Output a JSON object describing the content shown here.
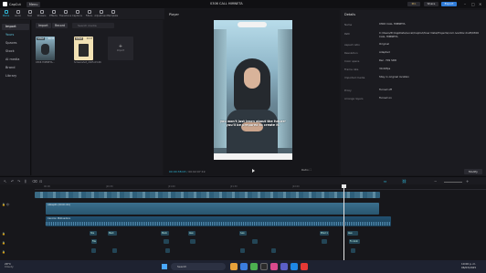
{
  "titlebar": {
    "app_name": "CapCut",
    "menu_label": "Menu",
    "project_name": "0306 CALL HIMNETA",
    "pro_label": "Pro",
    "share_label": "Share",
    "export_label": "Export",
    "minimize": "–",
    "maximize": "□",
    "close": "✕"
  },
  "toolbar": {
    "items": [
      {
        "label": "Media",
        "icon": "media-icon"
      },
      {
        "label": "Audio",
        "icon": "audio-icon"
      },
      {
        "label": "Text",
        "icon": "text-icon"
      },
      {
        "label": "Stickers",
        "icon": "stickers-icon"
      },
      {
        "label": "Effects",
        "icon": "effects-icon"
      },
      {
        "label": "Transitions",
        "icon": "transitions-icon"
      },
      {
        "label": "Captions",
        "icon": "captions-icon"
      },
      {
        "label": "Filters",
        "icon": "filters-icon"
      },
      {
        "label": "Adjustment",
        "icon": "adjustment-icon"
      },
      {
        "label": "Template",
        "icon": "template-icon"
      }
    ]
  },
  "leftnav": {
    "items": [
      {
        "label": "Import"
      },
      {
        "label": "Yours"
      },
      {
        "label": "Spaces"
      },
      {
        "label": "Stock"
      },
      {
        "label": "AI media"
      },
      {
        "label": "Brand"
      },
      {
        "label": "Library"
      }
    ]
  },
  "media": {
    "import_label": "Import",
    "record_label": "Record",
    "search_placeholder": "Search media",
    "thumbs": [
      {
        "label": "Added",
        "duration": "00:33",
        "name": "0306 HIMNETA..."
      },
      {
        "label": "Added",
        "duration": "00:03",
        "name": "Screenshot_2025-03-06"
      }
    ],
    "import_tile_label": "Import"
  },
  "player": {
    "title": "Player",
    "caption": "you won't just learn about the future- you'll be prepared to create it.",
    "time_current": "00:00:38:03",
    "time_total": "00:02:07:19",
    "ratio_label": "Ratio"
  },
  "details": {
    "title": "Details",
    "rows": [
      {
        "k": "Name",
        "v": "0306 CALL HIMNETA"
      },
      {
        "k": "Path",
        "v": "C:/Users/Pc/AppData/Local/CapCut/User Data/Projects/com.lveditor.draft/0306 CALL HIMNETA"
      },
      {
        "k": "Aspect ratio",
        "v": "Original"
      },
      {
        "k": "Resolution",
        "v": "Adapted"
      },
      {
        "k": "Color space",
        "v": "Rec. 709 SDR"
      },
      {
        "k": "Frame rate",
        "v": "30.00fps"
      },
      {
        "k": "Imported media",
        "v": "Stay in original location"
      },
      {
        "k": "Proxy",
        "v": "Turned off"
      },
      {
        "k": "Arrange layers",
        "v": "Turned on"
      }
    ],
    "modify_label": "Modify"
  },
  "timeline": {
    "ticks": [
      "00:00",
      "|00:30",
      "|01:00",
      "|01:30",
      "|02:00"
    ],
    "tracks": [
      {
        "label": "Cover"
      },
      {
        "label": "Video"
      },
      {
        "label": "Audio"
      },
      {
        "label": "Text"
      },
      {
        "label": "Text"
      },
      {
        "label": "Text"
      }
    ],
    "clip_labels": {
      "video": "Ailkep01 (00:01:04)",
      "audio": "Cancion Motivadora",
      "texts": [
        "Hos",
        "Ment",
        "Munk",
        "Alex",
        "Ivan",
        "Eltud 1",
        "Alex",
        "Flla",
        "Fn dodn"
      ]
    }
  },
  "taskbar": {
    "weather_temp": "29°C",
    "weather_desc": "Cloudy",
    "search_placeholder": "Search",
    "time": "10:06 p. m.",
    "date": "06/03/2025"
  },
  "colors": {
    "accent": "#2fb6d6",
    "export": "#2f7bd6",
    "background": "#17171b"
  }
}
